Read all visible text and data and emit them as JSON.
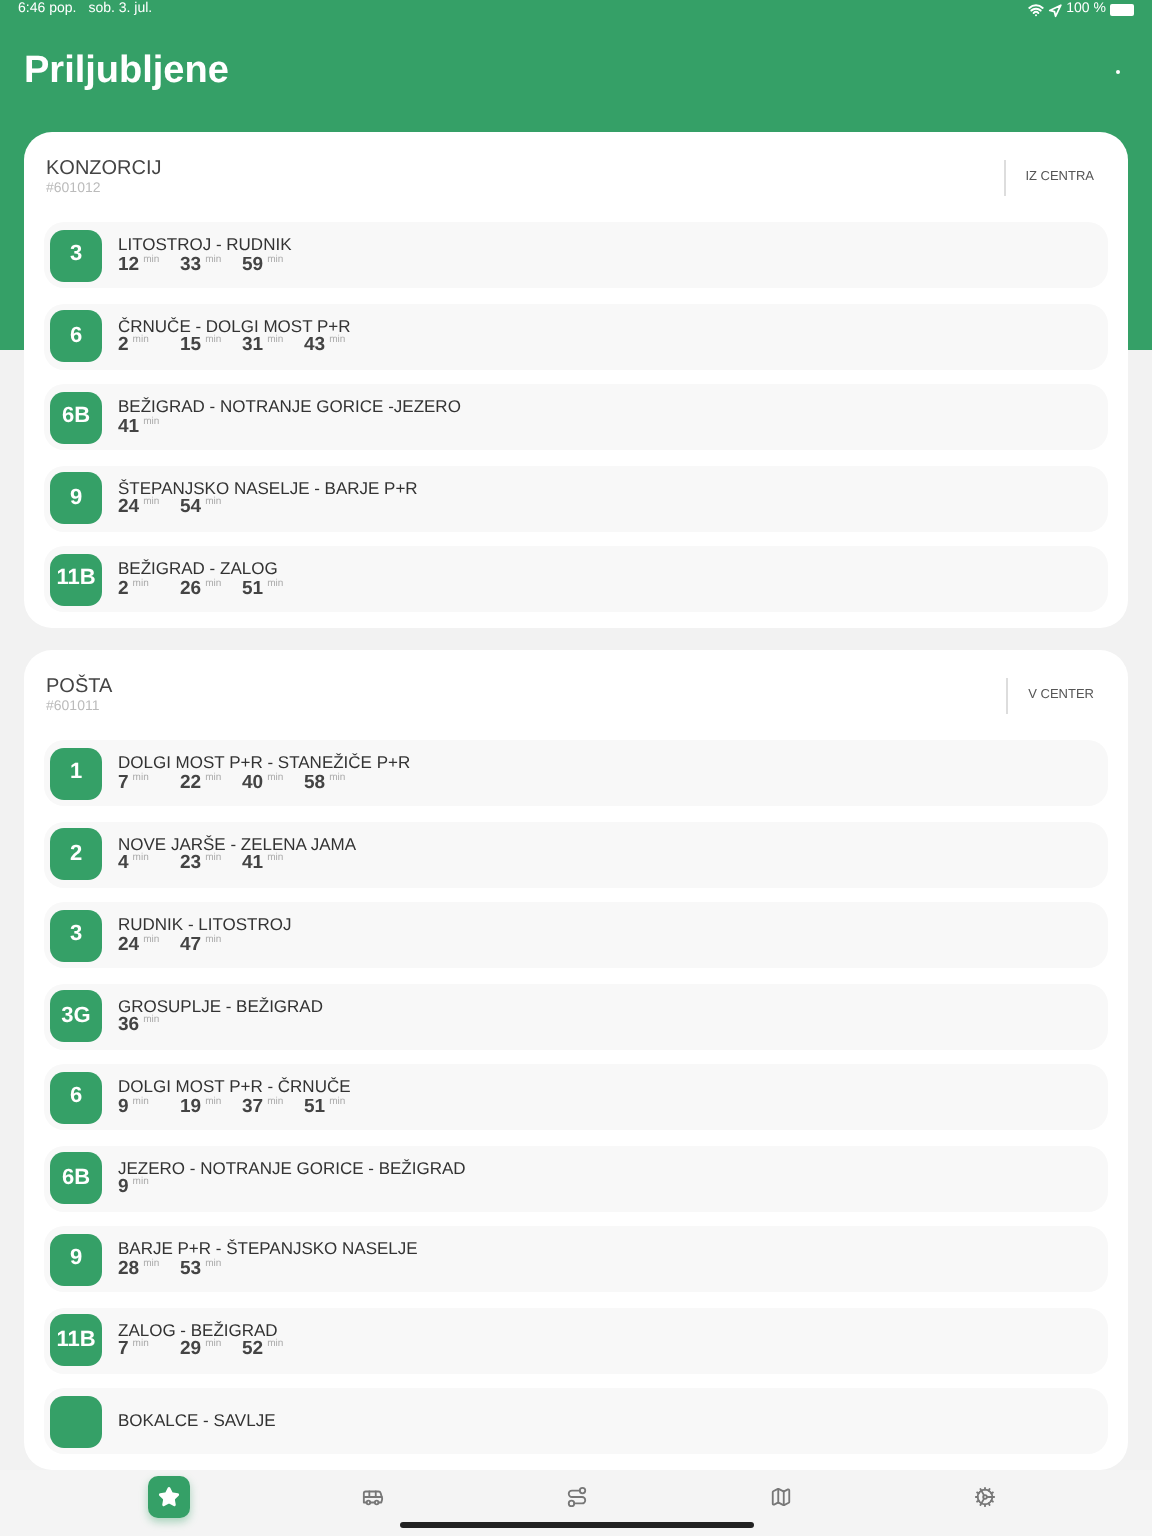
{
  "status_bar": {
    "time": "6:46 pop.",
    "date": "sob. 3. jul.",
    "battery": "100 %"
  },
  "title": "Priljubljene",
  "stations": [
    {
      "name": "KONZORCIJ",
      "code": "#601012",
      "direction": "IZ CENTRA",
      "routes": [
        {
          "line": "3",
          "title": "LITOSTROJ - RUDNIK",
          "times": [
            {
              "value": "12",
              "unit": "min"
            },
            {
              "value": "33",
              "unit": "min"
            },
            {
              "value": "59",
              "unit": "min"
            }
          ]
        },
        {
          "line": "6",
          "title": "ČRNUČE - DOLGI MOST P+R",
          "times": [
            {
              "value": "2",
              "unit": "min"
            },
            {
              "value": "15",
              "unit": "min"
            },
            {
              "value": "31",
              "unit": "min"
            },
            {
              "value": "43",
              "unit": "min"
            }
          ]
        },
        {
          "line": "6B",
          "title": "BEŽIGRAD - NOTRANJE GORICE -JEZERO",
          "times": [
            {
              "value": "41",
              "unit": "min"
            }
          ]
        },
        {
          "line": "9",
          "title": "ŠTEPANJSKO NASELJE - BARJE P+R",
          "times": [
            {
              "value": "24",
              "unit": "min"
            },
            {
              "value": "54",
              "unit": "min"
            }
          ]
        },
        {
          "line": "11B",
          "title": "BEŽIGRAD - ZALOG",
          "times": [
            {
              "value": "2",
              "unit": "min"
            },
            {
              "value": "26",
              "unit": "min"
            },
            {
              "value": "51",
              "unit": "min"
            }
          ]
        }
      ]
    },
    {
      "name": "POŠTA",
      "code": "#601011",
      "direction": "V CENTER",
      "routes": [
        {
          "line": "1",
          "title": "DOLGI MOST P+R - STANEŽIČE P+R",
          "times": [
            {
              "value": "7",
              "unit": "min"
            },
            {
              "value": "22",
              "unit": "min"
            },
            {
              "value": "40",
              "unit": "min"
            },
            {
              "value": "58",
              "unit": "min"
            }
          ]
        },
        {
          "line": "2",
          "title": "NOVE JARŠE - ZELENA JAMA",
          "times": [
            {
              "value": "4",
              "unit": "min"
            },
            {
              "value": "23",
              "unit": "min"
            },
            {
              "value": "41",
              "unit": "min"
            }
          ]
        },
        {
          "line": "3",
          "title": "RUDNIK - LITOSTROJ",
          "times": [
            {
              "value": "24",
              "unit": "min"
            },
            {
              "value": "47",
              "unit": "min"
            }
          ]
        },
        {
          "line": "3G",
          "title": "GROSUPLJE - BEŽIGRAD",
          "times": [
            {
              "value": "36",
              "unit": "min"
            }
          ]
        },
        {
          "line": "6",
          "title": "DOLGI MOST P+R - ČRNUČE",
          "times": [
            {
              "value": "9",
              "unit": "min"
            },
            {
              "value": "19",
              "unit": "min"
            },
            {
              "value": "37",
              "unit": "min"
            },
            {
              "value": "51",
              "unit": "min"
            }
          ]
        },
        {
          "line": "6B",
          "title": "JEZERO - NOTRANJE GORICE - BEŽIGRAD",
          "times": [
            {
              "value": "9",
              "unit": "min"
            }
          ]
        },
        {
          "line": "9",
          "title": "BARJE P+R - ŠTEPANJSKO NASELJE",
          "times": [
            {
              "value": "28",
              "unit": "min"
            },
            {
              "value": "53",
              "unit": "min"
            }
          ]
        },
        {
          "line": "11B",
          "title": "ZALOG - BEŽIGRAD",
          "times": [
            {
              "value": "7",
              "unit": "min"
            },
            {
              "value": "29",
              "unit": "min"
            },
            {
              "value": "52",
              "unit": "min"
            }
          ]
        },
        {
          "title": "BOKALCE - SAVLJE"
        }
      ]
    }
  ],
  "tabs": [
    {
      "kind": "favorites",
      "selected": true
    },
    {
      "kind": "bus",
      "selected": false
    },
    {
      "kind": "route",
      "selected": false
    },
    {
      "kind": "map",
      "selected": false
    },
    {
      "kind": "settings",
      "selected": false
    }
  ]
}
